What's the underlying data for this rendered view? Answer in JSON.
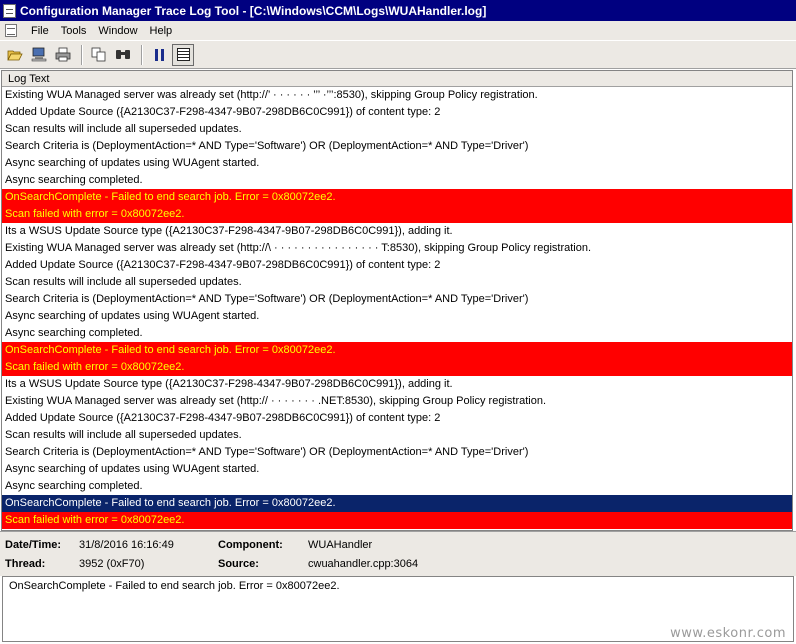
{
  "window": {
    "title": "Configuration Manager Trace Log Tool - [C:\\Windows\\CCM\\Logs\\WUAHandler.log]"
  },
  "menu": {
    "items": [
      "File",
      "Tools",
      "Window",
      "Help"
    ]
  },
  "toolbar": {
    "buttons": [
      "open-icon",
      "computer-icon",
      "print-icon",
      "copy-icon",
      "find-icon",
      "pause-icon",
      "list-view-icon"
    ]
  },
  "log": {
    "column_header": "Log Text",
    "rows": [
      {
        "text": "Existing WUA Managed server was already set (http://’      · · · · · ·     ’’’ ·’’’:8530), skipping Group Policy registration.",
        "kind": "normal"
      },
      {
        "text": "Added Update Source ({A2130C37-F298-4347-9B07-298DB6C0C991}) of content type: 2",
        "kind": "normal"
      },
      {
        "text": "Scan results will include all superseded updates.",
        "kind": "normal"
      },
      {
        "text": "Search Criteria is (DeploymentAction=* AND Type='Software') OR (DeploymentAction=* AND Type='Driver')",
        "kind": "normal"
      },
      {
        "text": "Async searching of updates using WUAgent started.",
        "kind": "normal"
      },
      {
        "text": "Async searching completed.",
        "kind": "normal"
      },
      {
        "text": "OnSearchComplete - Failed to end search job. Error = 0x80072ee2.",
        "kind": "error"
      },
      {
        "text": "Scan failed with error = 0x80072ee2.",
        "kind": "error"
      },
      {
        "text": "Its a WSUS Update Source type ({A2130C37-F298-4347-9B07-298DB6C0C991}), adding it.",
        "kind": "normal"
      },
      {
        "text": "Existing WUA Managed server was already set (http://\\ · · · · · · · · · · · · · · · · T:8530), skipping Group Policy registration.",
        "kind": "normal"
      },
      {
        "text": "Added Update Source ({A2130C37-F298-4347-9B07-298DB6C0C991}) of content type: 2",
        "kind": "normal"
      },
      {
        "text": "Scan results will include all superseded updates.",
        "kind": "normal"
      },
      {
        "text": "Search Criteria is (DeploymentAction=* AND Type='Software') OR (DeploymentAction=* AND Type='Driver')",
        "kind": "normal"
      },
      {
        "text": "Async searching of updates using WUAgent started.",
        "kind": "normal"
      },
      {
        "text": "Async searching completed.",
        "kind": "normal"
      },
      {
        "text": "OnSearchComplete - Failed to end search job. Error = 0x80072ee2.",
        "kind": "error"
      },
      {
        "text": "Scan failed with error = 0x80072ee2.",
        "kind": "error"
      },
      {
        "text": "Its a WSUS Update Source type ({A2130C37-F298-4347-9B07-298DB6C0C991}), adding it.",
        "kind": "normal"
      },
      {
        "text": "Existing WUA Managed server was already set (http://           · · · ·                · · ·       .NET:8530), skipping Group Policy registration.",
        "kind": "normal"
      },
      {
        "text": "Added Update Source ({A2130C37-F298-4347-9B07-298DB6C0C991}) of content type: 2",
        "kind": "normal"
      },
      {
        "text": "Scan results will include all superseded updates.",
        "kind": "normal"
      },
      {
        "text": "Search Criteria is (DeploymentAction=* AND Type='Software') OR (DeploymentAction=* AND Type='Driver')",
        "kind": "normal"
      },
      {
        "text": "Async searching of updates using WUAgent started.",
        "kind": "normal"
      },
      {
        "text": "Async searching completed.",
        "kind": "normal"
      },
      {
        "text": "OnSearchComplete - Failed to end search job. Error = 0x80072ee2.",
        "kind": "selected"
      },
      {
        "text": "Scan failed with error = 0x80072ee2.",
        "kind": "error"
      }
    ]
  },
  "details": {
    "datetime_label": "Date/Time:",
    "datetime_value": "31/8/2016 16:16:49",
    "component_label": "Component:",
    "component_value": "WUAHandler",
    "thread_label": "Thread:",
    "thread_value": "3952 (0xF70)",
    "source_label": "Source:",
    "source_value": "cwuahandler.cpp:3064"
  },
  "message": {
    "text": "OnSearchComplete - Failed to end search job. Error = 0x80072ee2."
  },
  "watermark": "www.eskonr.com",
  "colors": {
    "title_bar": "#000080",
    "error_row_bg": "#ff0000",
    "error_row_text": "#ffff00",
    "selected_row_bg": "#0a246a"
  }
}
